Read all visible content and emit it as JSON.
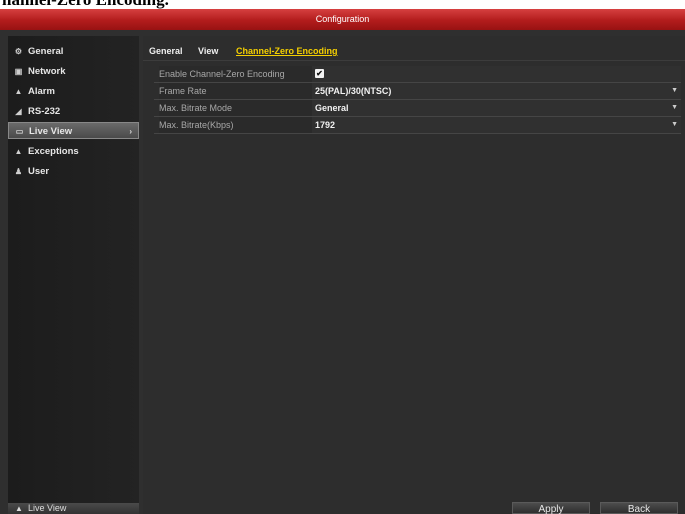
{
  "doc_heading": "hannel-Zero Encoding.",
  "window": {
    "title": "Configuration"
  },
  "sidebar": {
    "items": [
      {
        "label": "General",
        "icon": "gear-icon"
      },
      {
        "label": "Network",
        "icon": "network-icon"
      },
      {
        "label": "Alarm",
        "icon": "alarm-icon"
      },
      {
        "label": "RS-232",
        "icon": "serial-port-icon"
      },
      {
        "label": "Live View",
        "icon": "monitor-icon",
        "active": true
      },
      {
        "label": "Exceptions",
        "icon": "warning-icon"
      },
      {
        "label": "User",
        "icon": "user-icon"
      }
    ],
    "bottom_label": "Live View"
  },
  "tabs": [
    {
      "label": "General"
    },
    {
      "label": "View"
    },
    {
      "label": "Channel-Zero Encoding",
      "active": true
    }
  ],
  "settings": [
    {
      "label": "Enable Channel-Zero Encoding",
      "type": "checkbox",
      "checked": true
    },
    {
      "label": "Frame Rate",
      "type": "dropdown",
      "value": "25(PAL)/30(NTSC)"
    },
    {
      "label": "Max. Bitrate Mode",
      "type": "dropdown",
      "value": "General"
    },
    {
      "label": "Max. Bitrate(Kbps)",
      "type": "dropdown",
      "value": "1792"
    }
  ],
  "buttons": {
    "apply": "Apply",
    "back": "Back"
  },
  "colors": {
    "titlebar": "#b21c1c",
    "active_tab": "#f5d000",
    "background": "#2d2d2d"
  }
}
